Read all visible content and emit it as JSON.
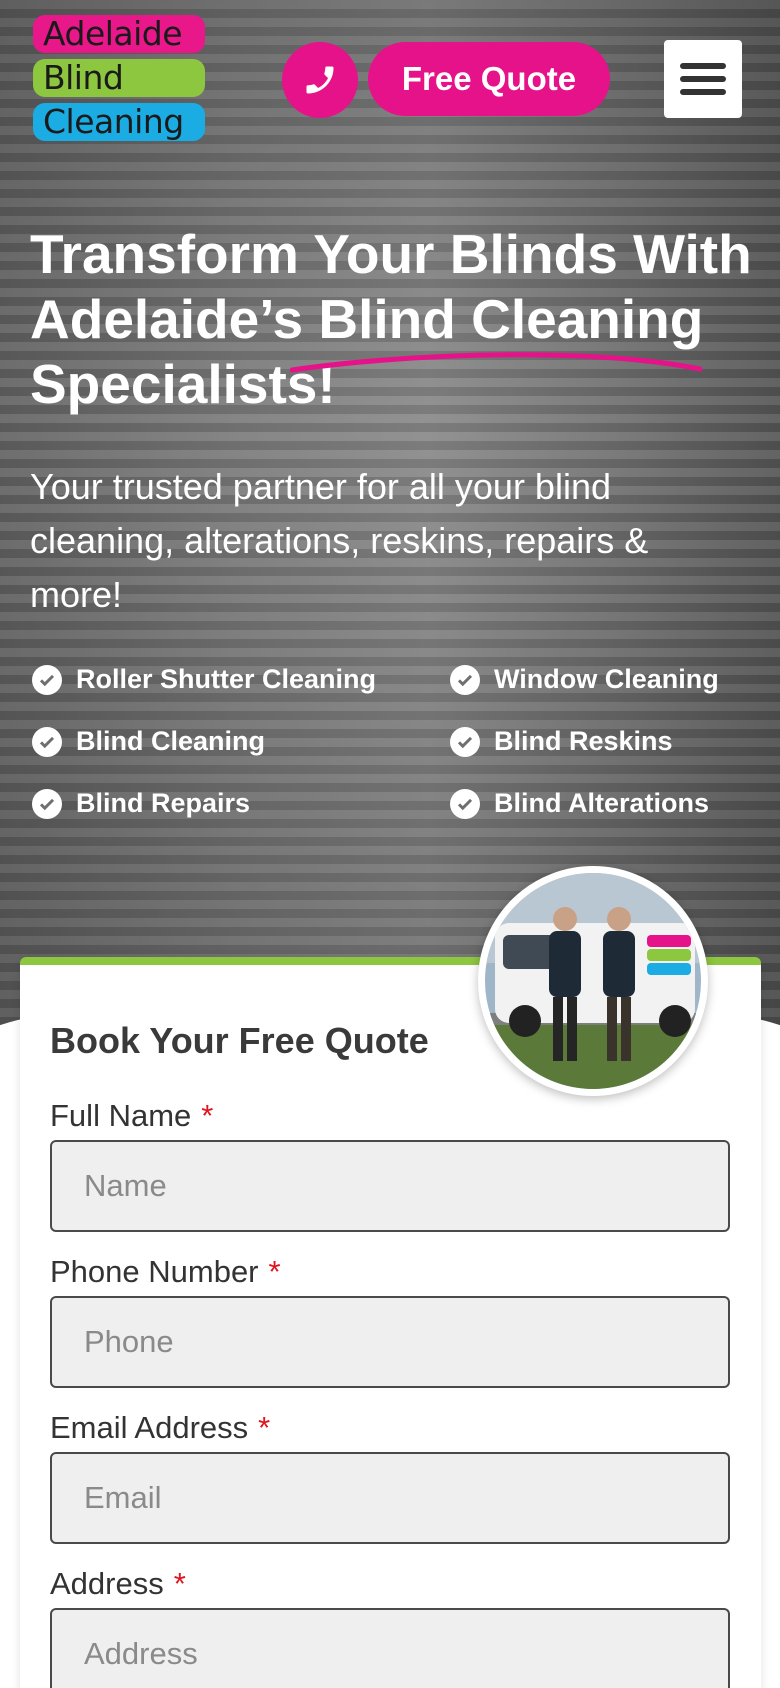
{
  "header": {
    "logo_lines": [
      "Adelaide",
      "Blind",
      "Cleaning"
    ],
    "quote_button": "Free Quote",
    "phone_icon": "phone-icon",
    "menu_icon": "hamburger-menu-icon"
  },
  "hero": {
    "headline_line1": "Transform Your Blinds With",
    "headline_line2": "Adelaide’s Blind Cleaning",
    "headline_line3": "Specialists!",
    "subtitle": "Your trusted partner for all your blind cleaning, alterations, reskins, repairs & more!",
    "features": [
      "Roller Shutter Cleaning",
      "Window Cleaning",
      "Blind Cleaning",
      "Blind Reskins",
      "Blind Repairs",
      "Blind Alterations"
    ]
  },
  "form": {
    "title": "Book Your Free Quote",
    "fields": [
      {
        "label": "Full Name",
        "placeholder": "Name",
        "required_mark": "*"
      },
      {
        "label": "Phone Number",
        "placeholder": "Phone",
        "required_mark": "*"
      },
      {
        "label": "Email Address",
        "placeholder": "Email",
        "required_mark": "*"
      },
      {
        "label": "Address",
        "placeholder": "Address",
        "required_mark": "*"
      }
    ]
  },
  "colors": {
    "brand_pink": "#e6128a",
    "brand_green": "#8dc63f",
    "brand_blue": "#1aace3",
    "required": "#e0141e"
  }
}
